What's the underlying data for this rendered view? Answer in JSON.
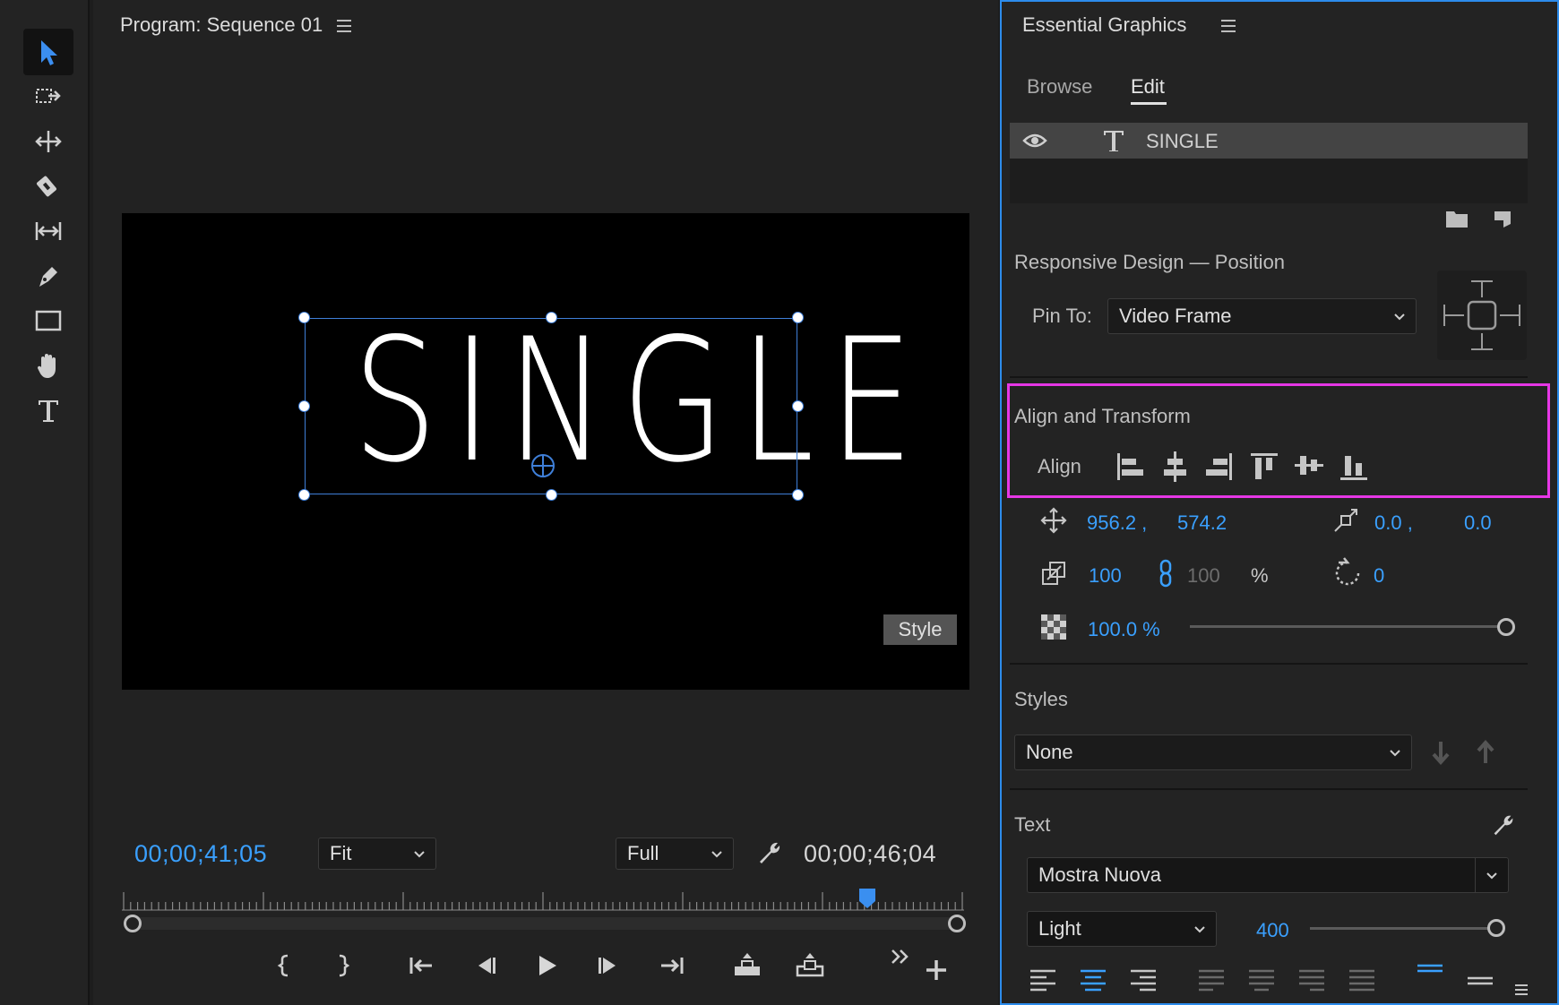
{
  "tools": [
    "selection-tool",
    "track-select-tool",
    "ripple-edit-tool",
    "razor-tool",
    "slip-tool",
    "pen-tool",
    "rectangle-tool",
    "hand-tool",
    "type-tool"
  ],
  "program": {
    "title": "Program: Sequence 01",
    "canvas_text": "SINGLE",
    "style_badge": "Style",
    "current_time": "00;00;41;05",
    "duration": "00;00;46;04",
    "zoom": "Fit",
    "resolution": "Full"
  },
  "eg": {
    "title": "Essential Graphics",
    "tabs": [
      "Browse",
      "Edit"
    ],
    "active_tab": "Edit",
    "layer_name": "SINGLE",
    "responsive_heading": "Responsive Design — Position",
    "pin_to_label": "Pin To:",
    "pin_to_value": "Video Frame",
    "align_transform_heading": "Align and Transform",
    "align_label": "Align",
    "position_x": "956.2 ,",
    "position_y": "574.2",
    "anchor_x": "0.0 ,",
    "anchor_y": "0.0",
    "scale": "100",
    "scale_linked": "100",
    "scale_unit": "%",
    "rotation": "0",
    "opacity": "100.0 %",
    "styles_heading": "Styles",
    "style_value": "None",
    "text_heading": "Text",
    "font": "Mostra Nuova",
    "font_style": "Light",
    "font_size": "400"
  },
  "colors": {
    "accent_blue": "#3aa0ff",
    "highlight_magenta": "#e637e6",
    "panel_focus": "#2d8ceb"
  }
}
